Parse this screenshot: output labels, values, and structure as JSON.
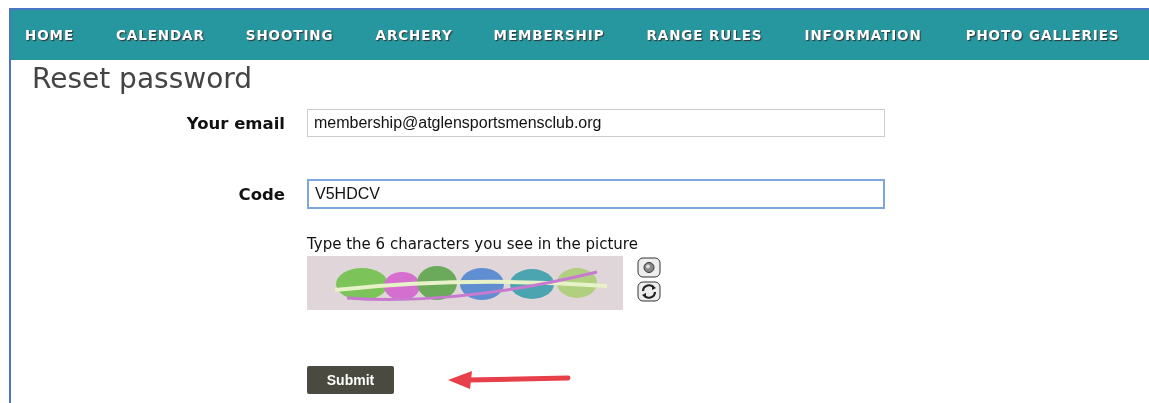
{
  "nav": {
    "items": [
      {
        "label": "HOME"
      },
      {
        "label": "CALENDAR"
      },
      {
        "label": "SHOOTING"
      },
      {
        "label": "ARCHERY"
      },
      {
        "label": "MEMBERSHIP"
      },
      {
        "label": "RANGE RULES"
      },
      {
        "label": "INFORMATION"
      },
      {
        "label": "PHOTO GALLERIES"
      }
    ]
  },
  "title": "Reset password",
  "fields": [
    {
      "label": "Your email",
      "value": "membership@atglensportsmensclub.org",
      "focused": false
    },
    {
      "label": "Code",
      "value": "V5HDCV",
      "focused": true
    }
  ],
  "captcha": {
    "hint": "Type the 6 characters you see in the picture"
  },
  "submit": {
    "label": "Submit"
  }
}
